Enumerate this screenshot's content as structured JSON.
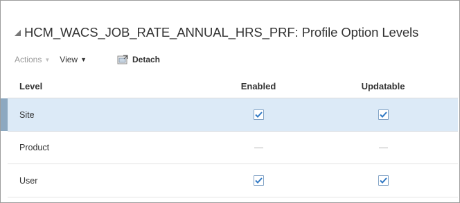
{
  "panel": {
    "title": "HCM_WACS_JOB_RATE_ANNUAL_HRS_PRF: Profile Option Levels",
    "collapse_icon": "triangle-collapse-icon"
  },
  "toolbar": {
    "actions_label": "Actions",
    "view_label": "View",
    "detach_label": "Detach",
    "caret_icon": "caret-down-icon",
    "detach_icon": "detach-window-icon"
  },
  "table": {
    "columns": [
      "Level",
      "Enabled",
      "Updatable"
    ],
    "rows": [
      {
        "level": "Site",
        "enabled": "checked",
        "updatable": "checked",
        "selected": true
      },
      {
        "level": "Product",
        "enabled": "not-applicable",
        "updatable": "not-applicable",
        "selected": false
      },
      {
        "level": "User",
        "enabled": "checked",
        "updatable": "checked",
        "selected": false
      }
    ]
  },
  "colors": {
    "selected_row": "#dceaf7",
    "selector_bar": "#8ca8c0",
    "checkmark": "#2f78c4",
    "muted_text": "#9a9a9a"
  }
}
